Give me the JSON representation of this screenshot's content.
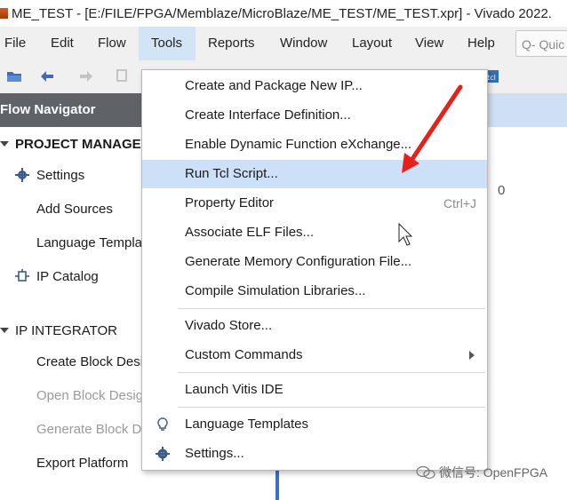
{
  "window": {
    "title": "ME_TEST - [E:/FILE/FPGA/Memblaze/MicroBlaze/ME_TEST/ME_TEST.xpr] - Vivado 2022."
  },
  "menubar": {
    "items": [
      {
        "label": "File"
      },
      {
        "label": "Edit"
      },
      {
        "label": "Flow"
      },
      {
        "label": "Tools",
        "active": true
      },
      {
        "label": "Reports"
      },
      {
        "label": "Window"
      },
      {
        "label": "Layout"
      },
      {
        "label": "View"
      },
      {
        "label": "Help"
      }
    ],
    "search_placeholder": "Q- Quic"
  },
  "flow_navigator": {
    "title": "Flow Navigator",
    "sections": [
      {
        "label": "PROJECT MANAGER",
        "items": [
          {
            "label": "Settings",
            "icon": "gear-icon"
          },
          {
            "label": "Add Sources"
          },
          {
            "label": "Language Templa"
          },
          {
            "label": "IP Catalog",
            "icon": "ip-catalog-icon"
          }
        ]
      },
      {
        "label": "IP INTEGRATOR",
        "items": [
          {
            "label": "Create Block Desi"
          },
          {
            "label": "Open Block Desig",
            "disabled": true
          },
          {
            "label": "Generate Block De",
            "disabled": true
          },
          {
            "label": "Export Platform"
          }
        ]
      }
    ]
  },
  "right_panel": {
    "value": "0"
  },
  "tools_menu": {
    "items": [
      {
        "label": "Create and Package New IP..."
      },
      {
        "label": "Create Interface Definition..."
      },
      {
        "label": "Enable Dynamic Function eXchange..."
      },
      {
        "label": "Run Tcl Script...",
        "highlighted": true
      },
      {
        "label": "Property Editor",
        "shortcut": "Ctrl+J"
      },
      {
        "label": "Associate ELF Files..."
      },
      {
        "label": "Generate Memory Configuration File..."
      },
      {
        "label": "Compile Simulation Libraries..."
      },
      {
        "label": "Vivado Store..."
      },
      {
        "label": "Custom Commands",
        "submenu": true
      },
      {
        "label": "Launch Vitis IDE"
      },
      {
        "label": "Language Templates",
        "icon": "lightbulb-icon"
      },
      {
        "label": "Settings...",
        "icon": "gear-icon"
      }
    ]
  },
  "colors": {
    "annotation_arrow": "#e8201b",
    "menu_highlight": "#cce0f7",
    "nav_header": "#5f6368"
  },
  "watermark": {
    "text": "微信号: OpenFPGA"
  }
}
